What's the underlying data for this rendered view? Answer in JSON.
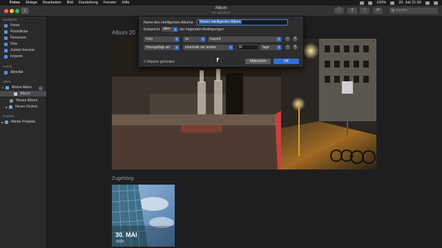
{
  "menubar": {
    "apple": "",
    "items": [
      "Fotos",
      "Ablage",
      "Bearbeiten",
      "Bild",
      "Darstellung",
      "Fenster",
      "Hilfe"
    ],
    "status_battery": "100%",
    "clock": "20. Juli  21:56"
  },
  "window": {
    "title": "Album",
    "subtitle": "09. Mai 2018",
    "back_label": "‹",
    "search_placeholder": "Suchen"
  },
  "sidebar": {
    "library_section": "Mediathek",
    "library_items": [
      "Fotos",
      "Rückblicke",
      "Personen",
      "Orte",
      "Zuletzt benutzt",
      "Importe"
    ],
    "shared_section": "Geteilt",
    "shared_items": [
      "Aktivität"
    ],
    "albums_section": "Alben",
    "my_albums": "Meine Alben",
    "album_items": [
      "Album",
      "Neues Album",
      "Neuer Ordner"
    ],
    "projects_section": "Projekte",
    "my_projects": "Meine Projekte",
    "add_label": "+"
  },
  "main": {
    "album_heading": "Album   20",
    "related_heading": "Zugehörig",
    "memory_title": "30. MAI",
    "memory_year": "2019"
  },
  "dialog": {
    "name_label": "Name des intelligenten Albums:",
    "name_value": "Neues intelligentes Album",
    "match_prefix": "Entspricht",
    "match_value": "allen",
    "match_suffix": "der folgenden Bedingungen:",
    "rows": [
      {
        "field": "Foto",
        "operator": "ist",
        "value": "Favorit"
      },
      {
        "field": "Hinzugefügt am",
        "operator": "innerhalb der letzten",
        "number": "30",
        "unit": "Tage"
      }
    ],
    "count_text": "0 Objekte gefunden",
    "cancel_label": "Abbrechen",
    "ok_label": "OK",
    "remove_symbol": "−",
    "add_symbol": "+"
  },
  "colors": {
    "accent": "#2f6fd6",
    "sidebar_bg": "#2a2a2c",
    "content_bg": "#1e1e20"
  }
}
